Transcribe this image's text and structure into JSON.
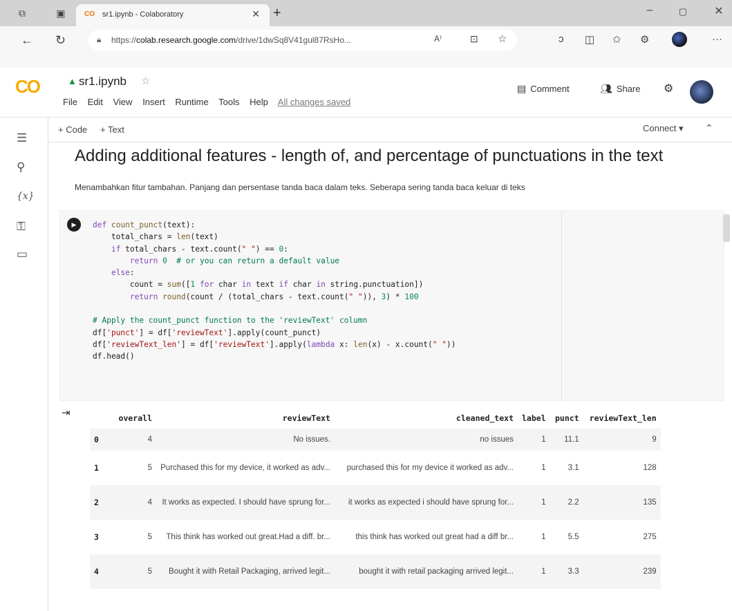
{
  "browser": {
    "tab_title": "sr1.ipynb - Colaboratory",
    "tab_logo": "CO",
    "url_prefix": "https://",
    "url_host": "colab.research.google.com",
    "url_rest": "/drive/1dwSq8V41gul87RsHo...",
    "icons": [
      "tab-actions-icon",
      "tab-list-icon",
      "back-icon",
      "refresh-icon",
      "lock-icon",
      "read-aloud-icon",
      "immersive-reader-icon",
      "favorite-icon",
      "copilot-icon",
      "split-screen-icon",
      "favorites-icon",
      "extensions-icon",
      "profile-icon",
      "more-icon"
    ]
  },
  "header": {
    "logo": "CO",
    "notebook_title": "sr1.ipynb",
    "menu": [
      "File",
      "Edit",
      "View",
      "Insert",
      "Runtime",
      "Tools",
      "Help"
    ],
    "save_status": "All changes saved",
    "comment_label": "Comment",
    "share_label": "Share"
  },
  "toolbar": {
    "add_code": "+ Code",
    "add_text": "+ Text",
    "connect": "Connect"
  },
  "markdown": {
    "heading": "Adding additional features - length of, and percentage of punctuations in the text",
    "subtext": "Menambahkan fitur tambahan. Panjang dan persentase tanda baca dalam teks. Seberapa sering tanda baca keluar di teks"
  },
  "table": {
    "columns": [
      "",
      "overall",
      "reviewText",
      "cleaned_text",
      "label",
      "punct",
      "reviewText_len"
    ],
    "rows": [
      {
        "idx": "0",
        "overall": "4",
        "review": "No issues.",
        "cleaned": "no issues",
        "label": "1",
        "punct": "11.1",
        "len": "9"
      },
      {
        "idx": "1",
        "overall": "5",
        "review": "Purchased this for my device, it worked as adv...",
        "cleaned": "purchased this for my device it worked as adv...",
        "label": "1",
        "punct": "3.1",
        "len": "128"
      },
      {
        "idx": "2",
        "overall": "4",
        "review": "It works as expected. I should have sprung for...",
        "cleaned": "it works as expected i should have sprung for...",
        "label": "1",
        "punct": "2.2",
        "len": "135"
      },
      {
        "idx": "3",
        "overall": "5",
        "review": "This think has worked out great.Had a diff. br...",
        "cleaned": "this think has worked out great had a diff br...",
        "label": "1",
        "punct": "5.5",
        "len": "275"
      },
      {
        "idx": "4",
        "overall": "5",
        "review": "Bought it with Retail Packaging, arrived legit...",
        "cleaned": "bought it with retail packaging arrived legit...",
        "label": "1",
        "punct": "3.3",
        "len": "239"
      }
    ]
  }
}
